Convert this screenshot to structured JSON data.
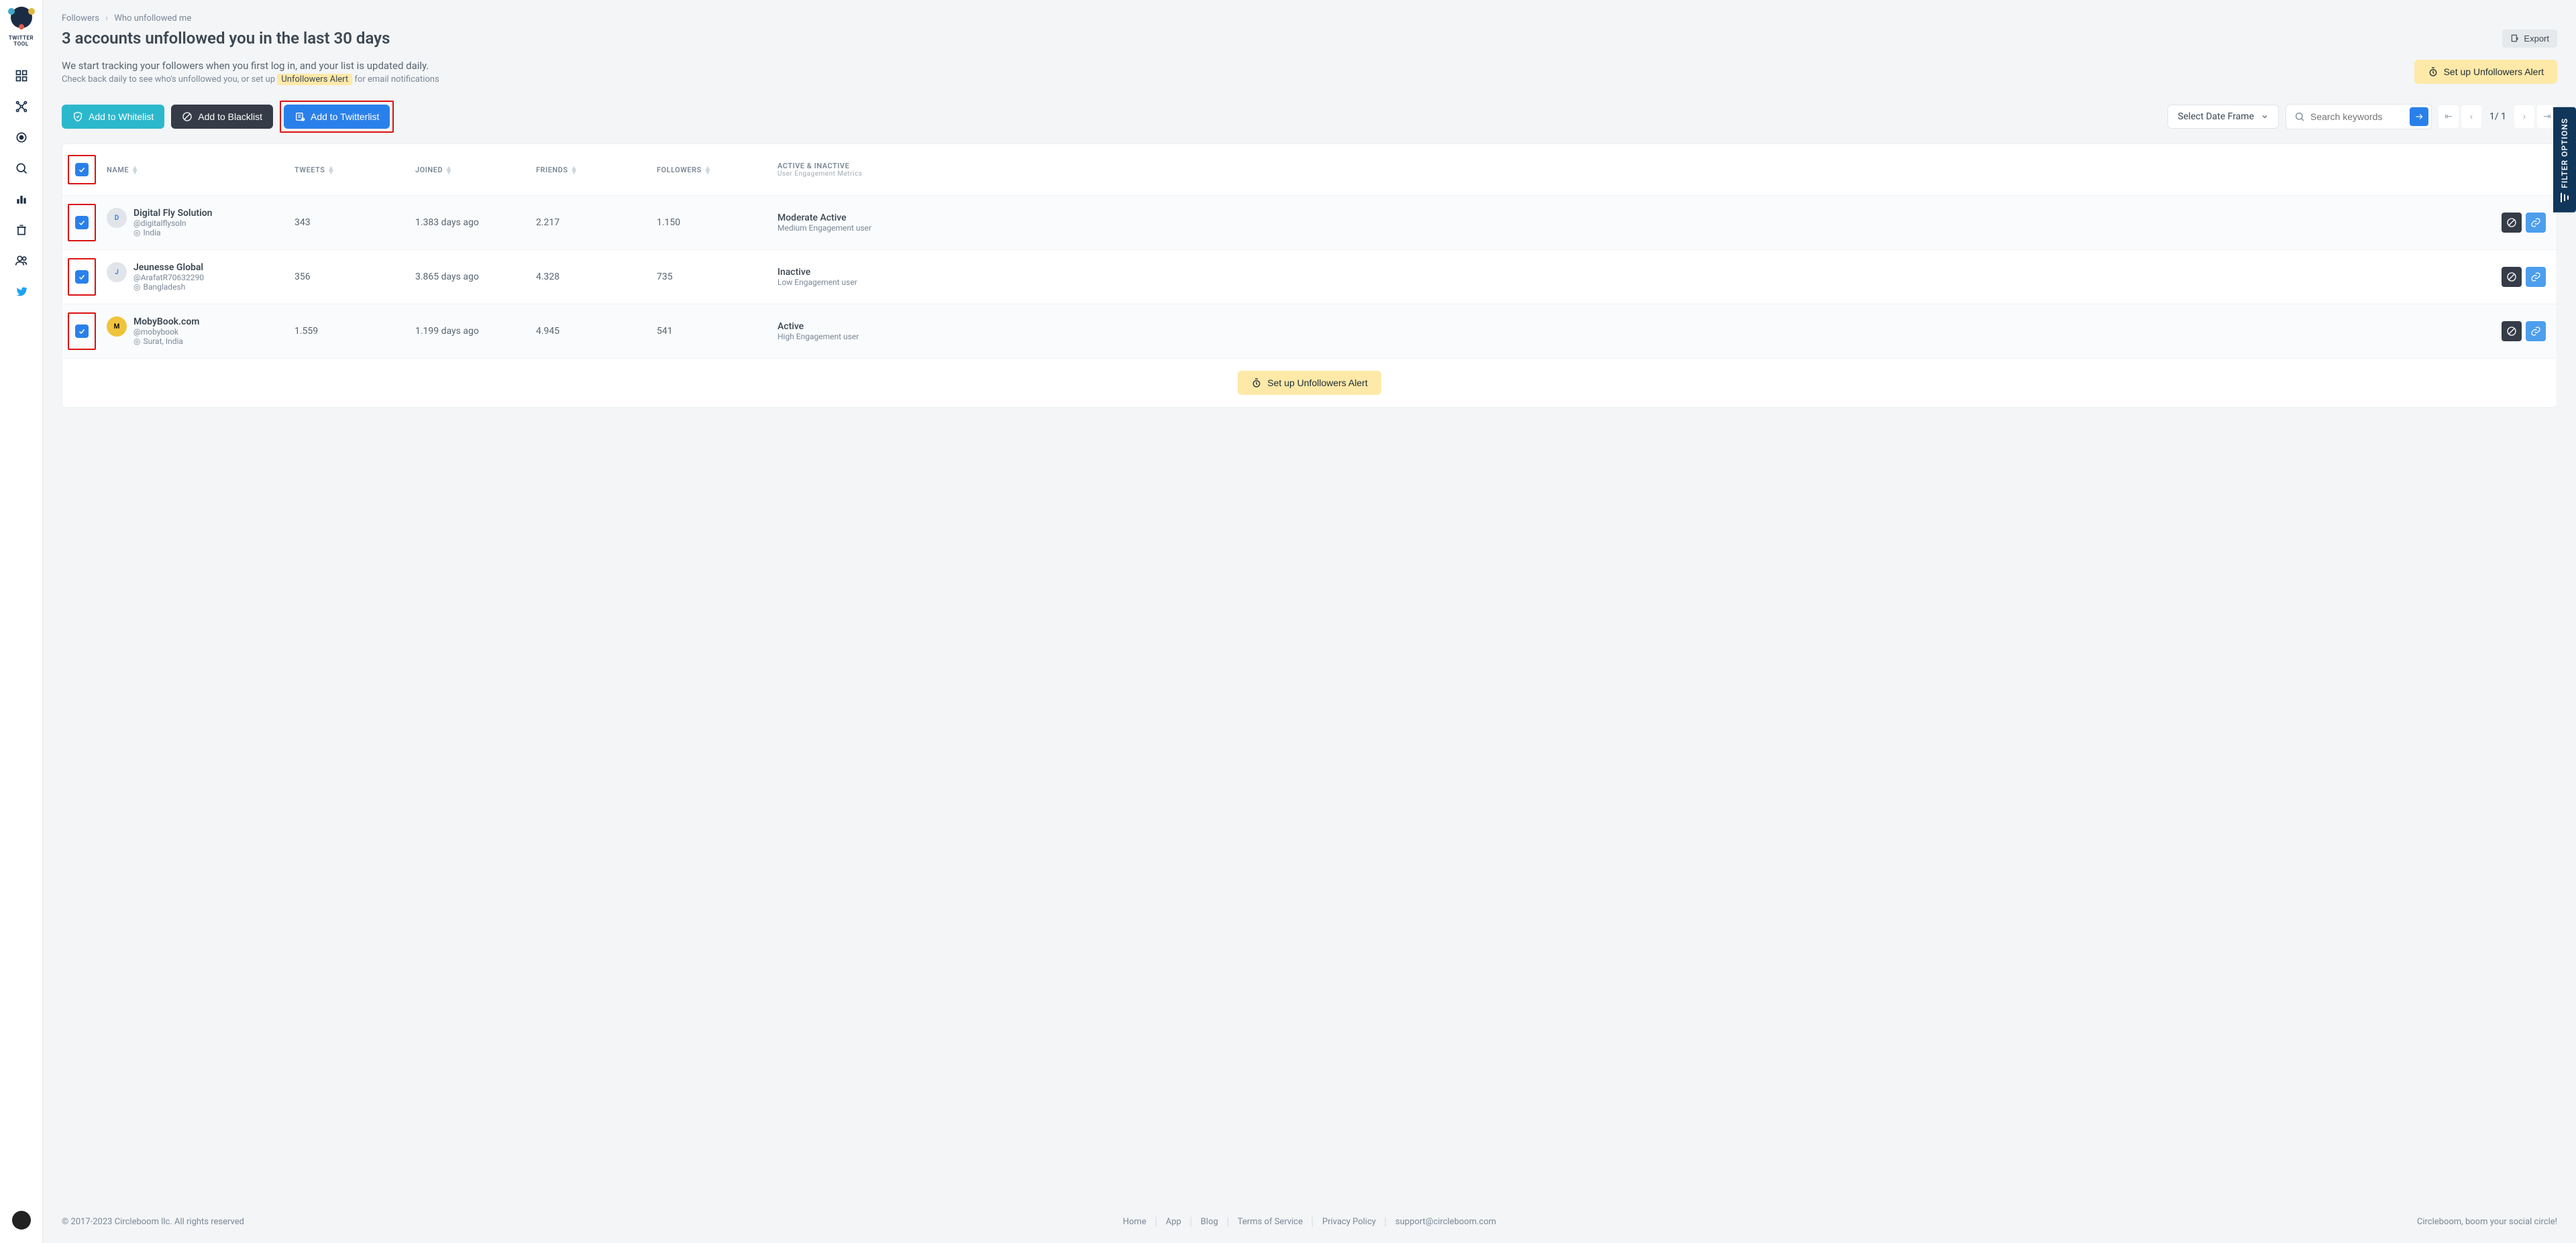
{
  "logo_text": "TWITTER TOOL",
  "breadcrumb": {
    "parent": "Followers",
    "current": "Who unfollowed me"
  },
  "page_title": "3 accounts unfollowed you in the last 30 days",
  "export_label": "Export",
  "intro_line1": "We start tracking your followers when you first log in, and your list is updated daily.",
  "intro_line2_pre": "Check back daily to see who's unfollowed you, or set up ",
  "intro_alert_chip": "Unfollowers Alert",
  "intro_line2_post": " for email notifications",
  "setup_alert_label": "Set up Unfollowers Alert",
  "toolbar": {
    "whitelist": "Add to Whitelist",
    "blacklist": "Add to Blacklist",
    "twitterlist": "Add to Twitterlist",
    "select_frame": "Select Date Frame",
    "search_placeholder": "Search keywords",
    "page_text": "1/ 1"
  },
  "columns": {
    "name": "NAME",
    "tweets": "TWEETS",
    "joined": "JOINED",
    "friends": "FRIENDS",
    "followers": "FOLLOWERS",
    "status": "ACTIVE & INACTIVE",
    "status_sub": "User Engagement Metrics"
  },
  "rows": [
    {
      "name": "Digital Fly Solution",
      "handle": "@digitalflysoln",
      "loc": "India",
      "tweets": "343",
      "joined": "1.383 days ago",
      "friends": "2.217",
      "followers": "1.150",
      "status": "Moderate Active",
      "status_sub": "Medium Engagement user",
      "av": "D",
      "av_class": ""
    },
    {
      "name": "Jeunesse Global",
      "handle": "@ArafatR70632290",
      "loc": "Bangladesh",
      "tweets": "356",
      "joined": "3.865 days ago",
      "friends": "4.328",
      "followers": "735",
      "status": "Inactive",
      "status_sub": "Low Engagement user",
      "av": "J",
      "av_class": ""
    },
    {
      "name": "MobyBook.com",
      "handle": "@mobybook",
      "loc": "Surat, India",
      "tweets": "1.559",
      "joined": "1.199 days ago",
      "friends": "4.945",
      "followers": "541",
      "status": "Active",
      "status_sub": "High Engagement user",
      "av": "M",
      "av_class": "av-yellow"
    }
  ],
  "bottom_alert_label": "Set up Unfollowers Alert",
  "footer": {
    "copyright": "© 2017-2023 Circleboom llc. All rights reserved",
    "links": [
      "Home",
      "App",
      "Blog",
      "Terms of Service",
      "Privacy Policy",
      "support@circleboom.com"
    ],
    "tagline": "Circleboom, boom your social circle!"
  },
  "filter_tab": "FILTER OPTIONS"
}
